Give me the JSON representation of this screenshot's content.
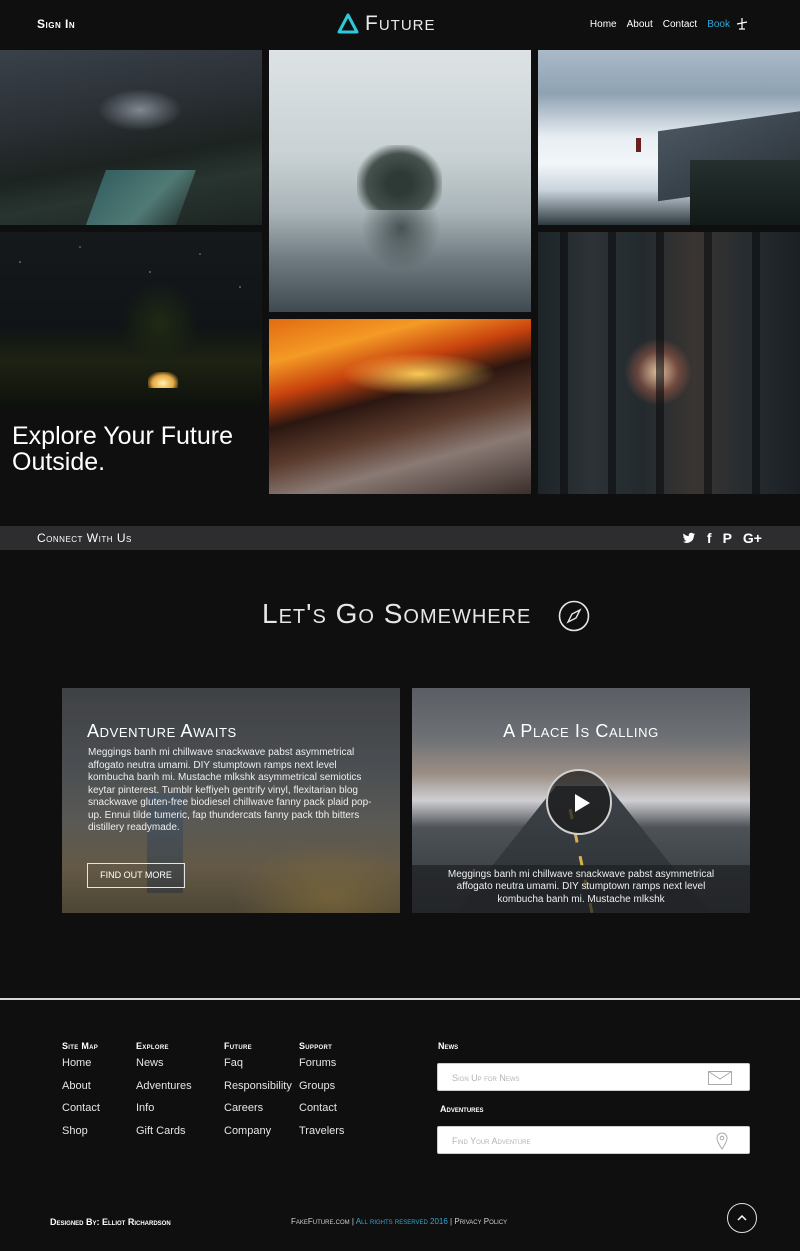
{
  "header": {
    "sign_in": "Sign In",
    "logo_text": "Future",
    "nav": [
      "Home",
      "About",
      "Contact",
      "Book"
    ]
  },
  "hero": {
    "headline_line1": "Explore Your Future",
    "headline_line2": "Outside."
  },
  "connect": {
    "label": "Connect With Us",
    "social": [
      "twitter-icon",
      "facebook-icon",
      "pinterest-icon",
      "google-plus-icon"
    ]
  },
  "section": {
    "title": "Let's Go Somewhere"
  },
  "cards": [
    {
      "title": "Adventure Awaits",
      "body": "Meggings banh mi chillwave snackwave pabst asymmetrical affogato neutra umami. DIY stumptown ramps next level kombucha banh mi. Mustache mlkshk asymmetrical semiotics keytar pinterest. Tumblr keffiyeh gentrify vinyl, flexitarian blog snackwave gluten-free biodiesel chillwave fanny pack plaid pop-up. Ennui tilde tumeric, fap thundercats fanny pack tbh bitters distillery readymade.",
      "button": "Find Out More"
    },
    {
      "title": "A Place Is Calling",
      "body": "Meggings banh mi chillwave snackwave pabst asymmetrical affogato neutra umami. DIY stumptown ramps next level kombucha banh mi. Mustache mlkshk"
    }
  ],
  "footer": {
    "columns": [
      {
        "heading": "Site Map",
        "links": [
          "Home",
          "About",
          "Contact",
          "Shop"
        ]
      },
      {
        "heading": "Explore",
        "links": [
          "News",
          "Adventures",
          "Info",
          "Gift Cards"
        ]
      },
      {
        "heading": "Future",
        "links": [
          "Faq",
          "Responsibility",
          "Careers",
          "Company"
        ]
      },
      {
        "heading": "Support",
        "links": [
          "Forums",
          "Groups",
          "Contact",
          "Travelers"
        ]
      }
    ],
    "news_heading": "News",
    "news_placeholder": "Sign Up for News",
    "adventures_heading": "Adventures",
    "adventures_placeholder": "Find Your Adventure",
    "designed_by": "Designed By: Elliot Richardson",
    "site": "FakeFuture.com",
    "rights": "All rights reserved 2016",
    "privacy": "Privacy Policy"
  },
  "colors": {
    "background": "#0f0f10",
    "accent": "#2ea8d8",
    "connect_bar": "#2d2d2f"
  }
}
